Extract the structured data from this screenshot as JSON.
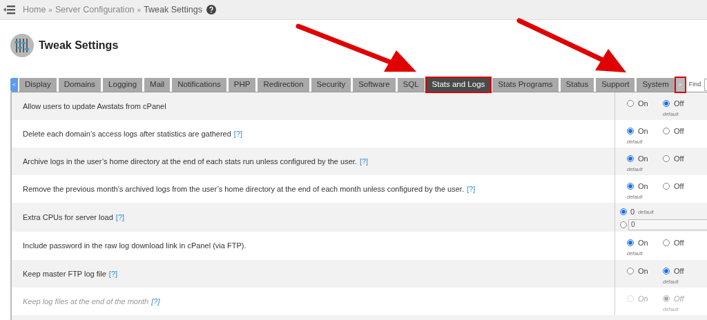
{
  "breadcrumb": {
    "items": [
      "Home",
      "Server Configuration",
      "Tweak Settings"
    ],
    "separator": "»"
  },
  "page_title": "Tweak Settings",
  "tabs": [
    {
      "label": "Display",
      "selected": false,
      "highlighted": false
    },
    {
      "label": "Domains",
      "selected": false,
      "highlighted": false
    },
    {
      "label": "Logging",
      "selected": false,
      "highlighted": false
    },
    {
      "label": "Mail",
      "selected": false,
      "highlighted": false
    },
    {
      "label": "Notifications",
      "selected": false,
      "highlighted": false
    },
    {
      "label": "PHP",
      "selected": false,
      "highlighted": false
    },
    {
      "label": "Redirection",
      "selected": false,
      "highlighted": false
    },
    {
      "label": "Security",
      "selected": false,
      "highlighted": false
    },
    {
      "label": "Software",
      "selected": false,
      "highlighted": false
    },
    {
      "label": "SQL",
      "selected": false,
      "highlighted": false
    },
    {
      "label": "Stats and Logs",
      "selected": true,
      "highlighted": true
    },
    {
      "label": "Stats Programs",
      "selected": false,
      "highlighted": false
    },
    {
      "label": "Status",
      "selected": false,
      "highlighted": false
    },
    {
      "label": "Support",
      "selected": false,
      "highlighted": false
    },
    {
      "label": "System",
      "selected": false,
      "highlighted": false
    }
  ],
  "tab_scroll": {
    "prev": "<",
    "next": ">",
    "next_highlighted": true
  },
  "find": {
    "label": "Find"
  },
  "settings": [
    {
      "kind": "toggle",
      "label": "Allow users to update Awstats from cPanel",
      "disabled": false,
      "options": [
        {
          "label": "On",
          "selected": false,
          "default": false
        },
        {
          "label": "Off",
          "selected": true,
          "default": true
        }
      ],
      "default_label": "default"
    },
    {
      "kind": "toggle",
      "label": "Delete each domain’s access logs after statistics are gathered",
      "help": "[?]",
      "disabled": false,
      "options": [
        {
          "label": "On",
          "selected": true,
          "default": true
        },
        {
          "label": "Off",
          "selected": false,
          "default": false
        }
      ],
      "default_label": "default"
    },
    {
      "kind": "toggle",
      "label": "Archive logs in the user’s home directory at the end of each stats run unless configured by the user.",
      "help": "[?]",
      "disabled": false,
      "options": [
        {
          "label": "On",
          "selected": true,
          "default": true
        },
        {
          "label": "Off",
          "selected": false,
          "default": false
        }
      ],
      "default_label": "default"
    },
    {
      "kind": "toggle",
      "label": "Remove the previous month’s archived logs from the user’s home directory at the end of each month unless configured by the user.",
      "help": "[?]",
      "disabled": false,
      "options": [
        {
          "label": "On",
          "selected": true,
          "default": true
        },
        {
          "label": "Off",
          "selected": false,
          "default": false
        }
      ],
      "default_label": "default"
    },
    {
      "kind": "number",
      "label": "Extra CPUs for server load",
      "help": "[?]",
      "disabled": false,
      "default_value": "0",
      "default_label": "default",
      "default_selected": true,
      "custom_value": "0"
    },
    {
      "kind": "toggle",
      "label": "Include password in the raw log download link in cPanel (via FTP).",
      "disabled": false,
      "options": [
        {
          "label": "On",
          "selected": true,
          "default": true
        },
        {
          "label": "Off",
          "selected": false,
          "default": false
        }
      ],
      "default_label": "default"
    },
    {
      "kind": "toggle",
      "label": "Keep master FTP log file",
      "help": "[?]",
      "disabled": false,
      "options": [
        {
          "label": "On",
          "selected": false,
          "default": false
        },
        {
          "label": "Off",
          "selected": true,
          "default": true
        }
      ],
      "default_label": "default"
    },
    {
      "kind": "toggle",
      "label": "Keep log files at the end of the month",
      "help": "[?]",
      "disabled": true,
      "options": [
        {
          "label": "On",
          "selected": false,
          "default": false
        },
        {
          "label": "Off",
          "selected": true,
          "default": true
        }
      ],
      "default_label": "default"
    }
  ]
}
